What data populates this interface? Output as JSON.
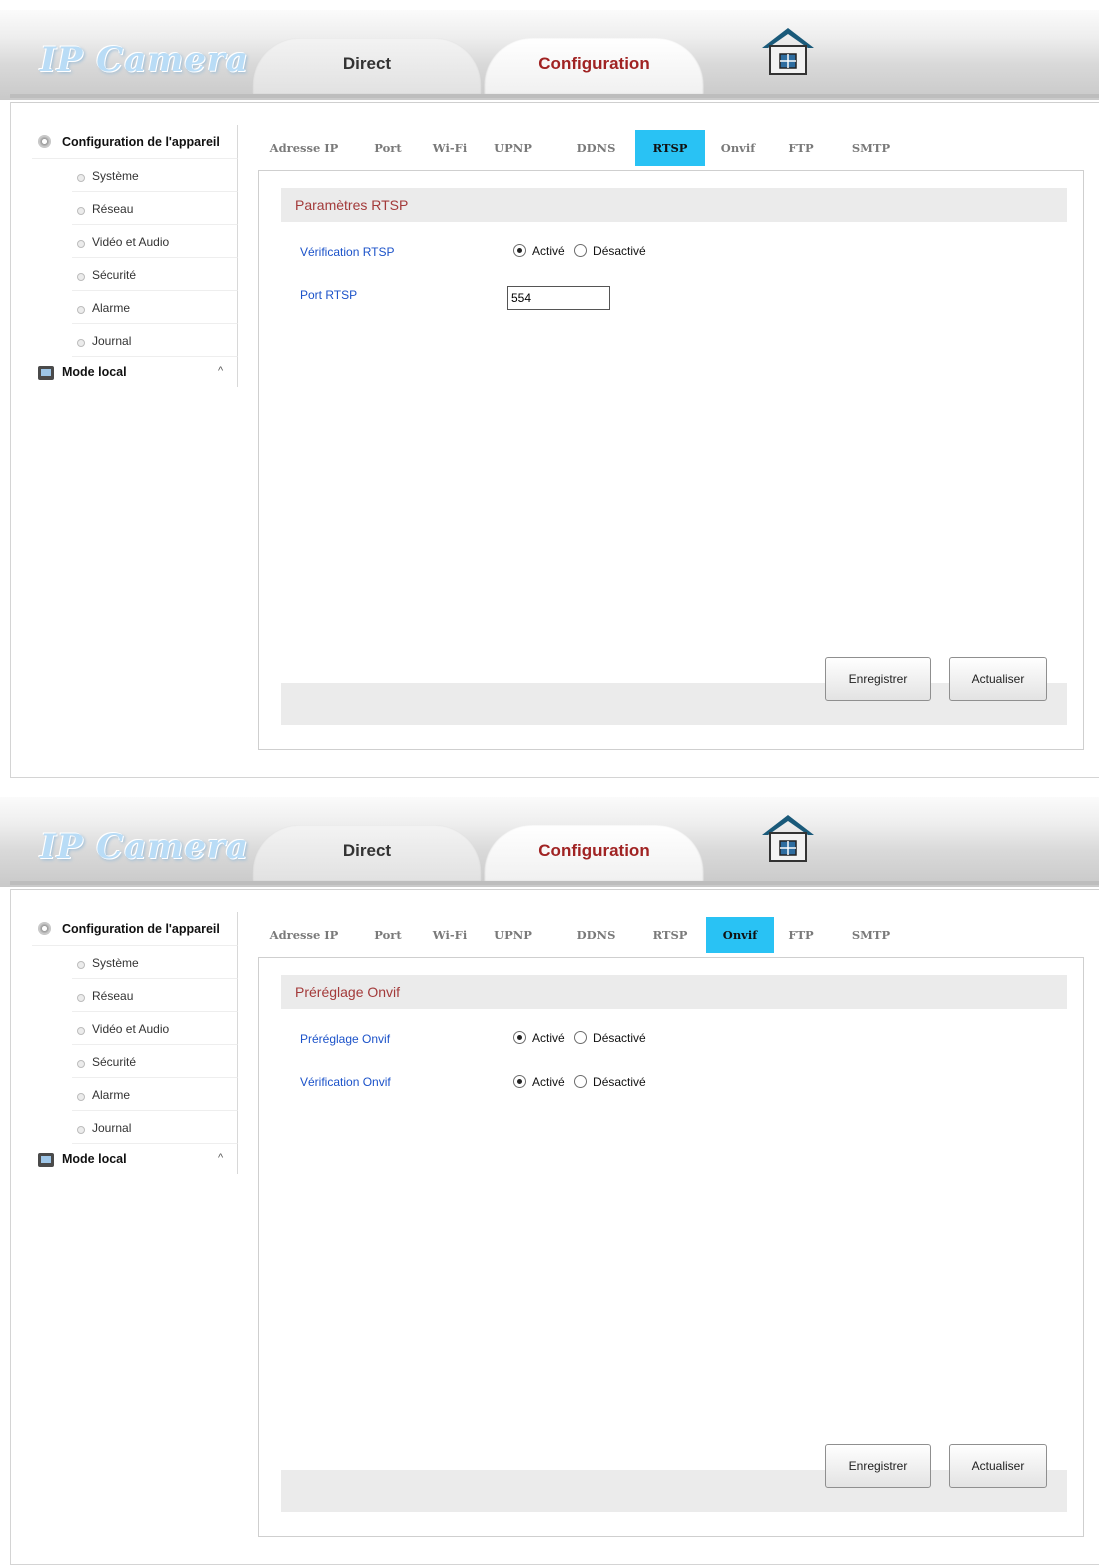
{
  "panels": [
    {
      "header": {
        "logo": "IP Camera",
        "tabs": [
          "Direct",
          "Configuration"
        ],
        "active_tab": "Configuration",
        "home_icon": "home-icon"
      },
      "sidebar": {
        "title": "Configuration de l'appareil",
        "items": [
          "Système",
          "Réseau",
          "Vidéo et Audio",
          "Sécurité",
          "Alarme",
          "Journal"
        ],
        "mode_local": "Mode local"
      },
      "subtabs": [
        "Adresse IP",
        "Port",
        "Wi-Fi",
        "UPNP",
        "DDNS",
        "RTSP",
        "Onvif",
        "FTP",
        "SMTP"
      ],
      "active_subtab": "RTSP",
      "section_title": "Paramètres RTSP",
      "rows": [
        {
          "label": "Vérification RTSP",
          "type": "radio",
          "options": [
            "Activé",
            "Désactivé"
          ],
          "selected": "Activé"
        },
        {
          "label": "Port RTSP",
          "type": "input",
          "value": "554"
        }
      ],
      "buttons": {
        "save": "Enregistrer",
        "refresh": "Actualiser"
      }
    },
    {
      "header": {
        "logo": "IP Camera",
        "tabs": [
          "Direct",
          "Configuration"
        ],
        "active_tab": "Configuration",
        "home_icon": "home-icon"
      },
      "sidebar": {
        "title": "Configuration de l'appareil",
        "items": [
          "Système",
          "Réseau",
          "Vidéo et Audio",
          "Sécurité",
          "Alarme",
          "Journal"
        ],
        "mode_local": "Mode local"
      },
      "subtabs": [
        "Adresse IP",
        "Port",
        "Wi-Fi",
        "UPNP",
        "DDNS",
        "RTSP",
        "Onvif",
        "FTP",
        "SMTP"
      ],
      "active_subtab": "Onvif",
      "section_title": "Préréglage Onvif",
      "rows": [
        {
          "label": "Préréglage Onvif",
          "type": "radio",
          "options": [
            "Activé",
            "Désactivé"
          ],
          "selected": "Activé"
        },
        {
          "label": "Vérification Onvif",
          "type": "radio",
          "options": [
            "Activé",
            "Désactivé"
          ],
          "selected": "Activé"
        }
      ],
      "buttons": {
        "save": "Enregistrer",
        "refresh": "Actualiser"
      }
    }
  ],
  "colors": {
    "active_subtab": "#29c2f4",
    "section_title": "#a33a3a",
    "row_label": "#1b52c9",
    "config_tab": "#a02323"
  }
}
